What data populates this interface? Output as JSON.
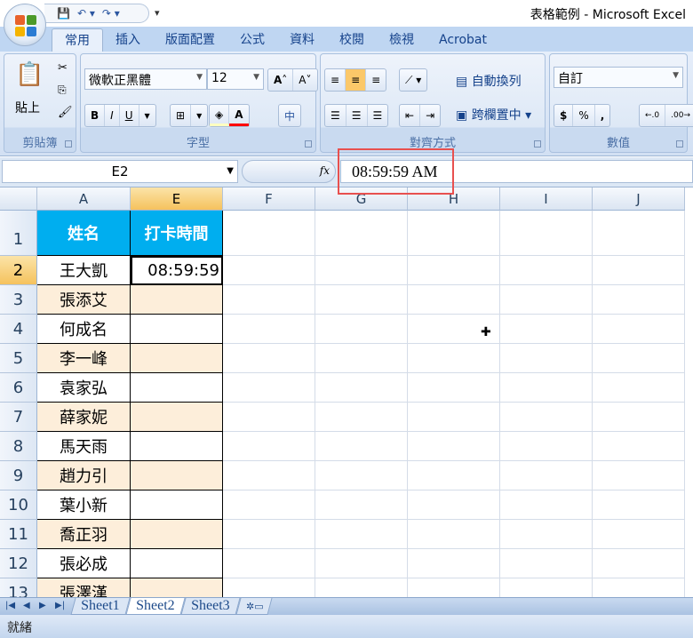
{
  "window": {
    "title": "表格範例 - Microsoft Excel"
  },
  "quick_access": {
    "icons": [
      "save-icon",
      "undo-icon",
      "redo-icon",
      "customize-icon"
    ]
  },
  "ribbon_tabs": [
    "常用",
    "插入",
    "版面配置",
    "公式",
    "資料",
    "校閱",
    "檢視",
    "Acrobat"
  ],
  "clipboard": {
    "paste_label": "貼上",
    "group_label": "剪貼簿"
  },
  "font": {
    "name": "微軟正黑體",
    "size": "12",
    "group_label": "字型",
    "bold": "B",
    "italic": "I",
    "underline": "U",
    "font_color": "A",
    "font_color_hex": "#ff0000",
    "fill_color_hex": "#ffffc0",
    "phonetic": "中"
  },
  "alignment": {
    "wrap_text": "自動換列",
    "merge_center": "跨欄置中",
    "group_label": "對齊方式"
  },
  "number": {
    "format": "自訂",
    "currency": "$",
    "percent": "%",
    "comma": ",",
    "group_label": "數值"
  },
  "formula_bar": {
    "name_box": "E2",
    "fx": "fx",
    "value": "08:59:59 AM"
  },
  "columns": [
    "A",
    "E",
    "F",
    "G",
    "H",
    "I",
    "J"
  ],
  "rows": [
    "1",
    "2",
    "3",
    "4",
    "5",
    "6",
    "7",
    "8",
    "9",
    "10",
    "11",
    "12",
    "13"
  ],
  "table": {
    "headers": [
      "姓名",
      "打卡時間"
    ],
    "names": [
      "王大凱",
      "張添艾",
      "何成名",
      "李一峰",
      "袁家弘",
      "薛家妮",
      "馬天雨",
      "趙力引",
      "葉小新",
      "喬正羽",
      "張必成",
      "張澤漢"
    ],
    "times": [
      "08:59:59",
      "",
      "",
      "",
      "",
      "",
      "",
      "",
      "",
      "",
      "",
      ""
    ],
    "header_color": "#00aeef",
    "alt_row_color": "#fdeeda"
  },
  "sheets": [
    "Sheet1",
    "Sheet2",
    "Sheet3"
  ],
  "active_sheet": "Sheet2",
  "status": {
    "text": "就緒"
  }
}
